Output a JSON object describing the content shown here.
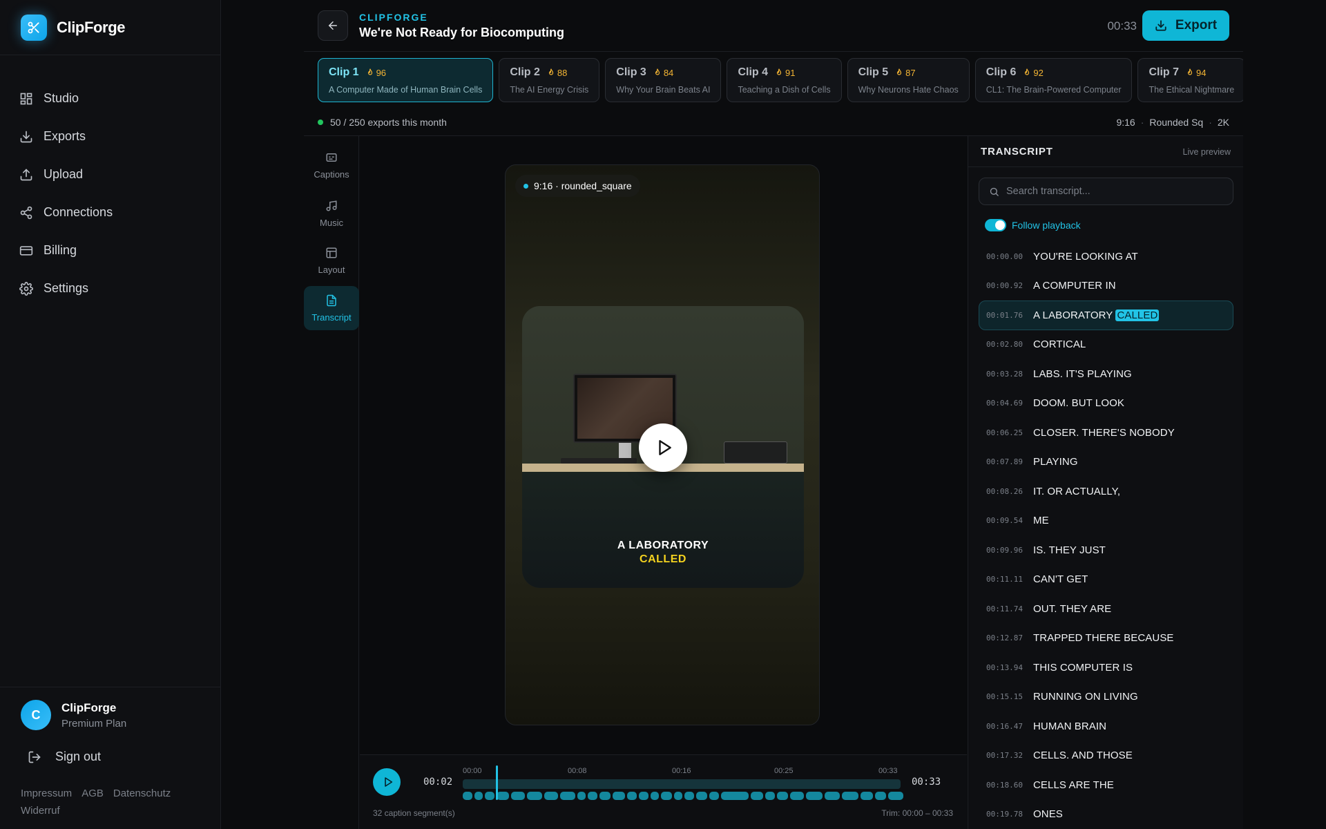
{
  "brand": {
    "name": "ClipForge"
  },
  "nav": [
    {
      "label": "Studio",
      "icon": "grid-icon"
    },
    {
      "label": "Exports",
      "icon": "download-icon"
    },
    {
      "label": "Upload",
      "icon": "upload-icon"
    },
    {
      "label": "Connections",
      "icon": "share-icon"
    },
    {
      "label": "Billing",
      "icon": "credit-card-icon"
    },
    {
      "label": "Settings",
      "icon": "gear-icon"
    }
  ],
  "user": {
    "initial": "C",
    "name": "ClipForge",
    "plan": "Premium Plan",
    "signout": "Sign out"
  },
  "footer_links": [
    "Impressum",
    "AGB",
    "Datenschutz",
    "Widerruf"
  ],
  "header": {
    "brand": "CLIPFORGE",
    "title": "We're Not Ready for Biocomputing",
    "time": "00:33",
    "export_label": "Export"
  },
  "clips": [
    {
      "name": "Clip 1",
      "score": "96",
      "subtitle": "A Computer Made of Human Brain Cells",
      "active": true
    },
    {
      "name": "Clip 2",
      "score": "88",
      "subtitle": "The AI Energy Crisis"
    },
    {
      "name": "Clip 3",
      "score": "84",
      "subtitle": "Why Your Brain Beats AI"
    },
    {
      "name": "Clip 4",
      "score": "91",
      "subtitle": "Teaching a Dish of Cells"
    },
    {
      "name": "Clip 5",
      "score": "87",
      "subtitle": "Why Neurons Hate Chaos"
    },
    {
      "name": "Clip 6",
      "score": "92",
      "subtitle": "CL1: The Brain-Powered Computer"
    },
    {
      "name": "Clip 7",
      "score": "94",
      "subtitle": "The Ethical Nightmare"
    }
  ],
  "status": {
    "exports": "50 / 250 exports this month",
    "ratio": "9:16",
    "shape": "Rounded Sq",
    "resolution": "2K"
  },
  "tools": [
    {
      "label": "Captions",
      "icon": "captions-icon"
    },
    {
      "label": "Music",
      "icon": "music-icon"
    },
    {
      "label": "Layout",
      "icon": "layout-icon"
    },
    {
      "label": "Transcript",
      "icon": "document-icon",
      "active": true
    }
  ],
  "preview": {
    "ratio_label": "9:16 · rounded_square",
    "caption_line1": "A LABORATORY",
    "caption_line2": "CALLED"
  },
  "timeline": {
    "current": "00:02",
    "end": "00:33",
    "ticks": [
      "00:00",
      "00:08",
      "00:16",
      "00:25",
      "00:33"
    ],
    "segments_label": "32 caption segment(s)",
    "trim": "Trim: 00:00 – 00:33",
    "playhead_fraction": 0.076
  },
  "transcript": {
    "title": "TRANSCRIPT",
    "live": "Live preview",
    "search_placeholder": "Search transcript...",
    "follow": "Follow playback",
    "rows": [
      {
        "ts": "00:00.00",
        "text": "YOU'RE LOOKING AT"
      },
      {
        "ts": "00:00.92",
        "text": "A COMPUTER IN"
      },
      {
        "ts": "00:01.76",
        "text": "A LABORATORY",
        "highlight": "CALLED",
        "active": true
      },
      {
        "ts": "00:02.80",
        "text": "CORTICAL"
      },
      {
        "ts": "00:03.28",
        "text": "LABS. IT'S PLAYING"
      },
      {
        "ts": "00:04.69",
        "text": "DOOM. BUT LOOK"
      },
      {
        "ts": "00:06.25",
        "text": "CLOSER. THERE'S NOBODY"
      },
      {
        "ts": "00:07.89",
        "text": "PLAYING"
      },
      {
        "ts": "00:08.26",
        "text": "IT. OR ACTUALLY,"
      },
      {
        "ts": "00:09.54",
        "text": "ME"
      },
      {
        "ts": "00:09.96",
        "text": "IS. THEY JUST"
      },
      {
        "ts": "00:11.11",
        "text": "CAN'T GET"
      },
      {
        "ts": "00:11.74",
        "text": "OUT. THEY ARE"
      },
      {
        "ts": "00:12.87",
        "text": "TRAPPED THERE BECAUSE"
      },
      {
        "ts": "00:13.94",
        "text": "THIS COMPUTER IS"
      },
      {
        "ts": "00:15.15",
        "text": "RUNNING ON LIVING"
      },
      {
        "ts": "00:16.47",
        "text": "HUMAN BRAIN"
      },
      {
        "ts": "00:17.32",
        "text": "CELLS. AND THOSE"
      },
      {
        "ts": "00:18.60",
        "text": "CELLS ARE THE"
      },
      {
        "ts": "00:19.78",
        "text": "ONES"
      }
    ]
  },
  "colors": {
    "accent": "#0fb6d6",
    "score": "#f4b534",
    "caption_highlight": "#f4d21f"
  }
}
